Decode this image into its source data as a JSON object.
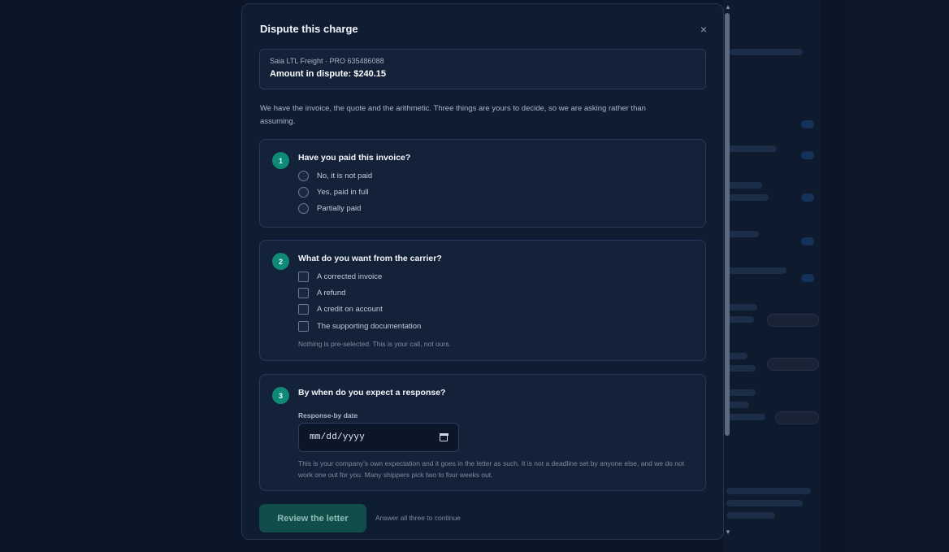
{
  "modal": {
    "title": "Dispute this charge",
    "close_label": "×"
  },
  "summary": {
    "meta": "Saia LTL Freight · PRO 635486088",
    "amount": "Amount in dispute: $240.15"
  },
  "intro": "We have the invoice, the quote and the arithmetic. Three things are yours to decide, so we are asking rather than assuming.",
  "q1": {
    "number": "1",
    "question": "Have you paid this invoice?",
    "options": [
      "No, it is not paid",
      "Yes, paid in full",
      "Partially paid"
    ]
  },
  "q2": {
    "number": "2",
    "question": "What do you want from the carrier?",
    "options": [
      "A corrected invoice",
      "A refund",
      "A credit on account",
      "The supporting documentation"
    ],
    "hint": "Nothing is pre-selected. This is your call, not ours."
  },
  "q3": {
    "number": "3",
    "question": "By when do you expect a response?",
    "field_label": "Response-by date",
    "date_placeholder": "mm/dd/yyyy",
    "description": "This is your company's own expectation and it goes in the letter as such. It is not a deadline set by anyone else, and we do not work one out for you. Many shippers pick two to four weeks out."
  },
  "actions": {
    "review_label": "Review the letter",
    "hint": "Answer all three to continue"
  },
  "colors": {
    "accent": "#0e8a77",
    "cta_disabled": "#114d4a",
    "modal_bg": "#0f1d33"
  },
  "icons": {
    "close": "close-icon",
    "calendar": "calendar-icon",
    "scroll_up": "chevron-up-icon",
    "scroll_down": "chevron-down-icon"
  }
}
